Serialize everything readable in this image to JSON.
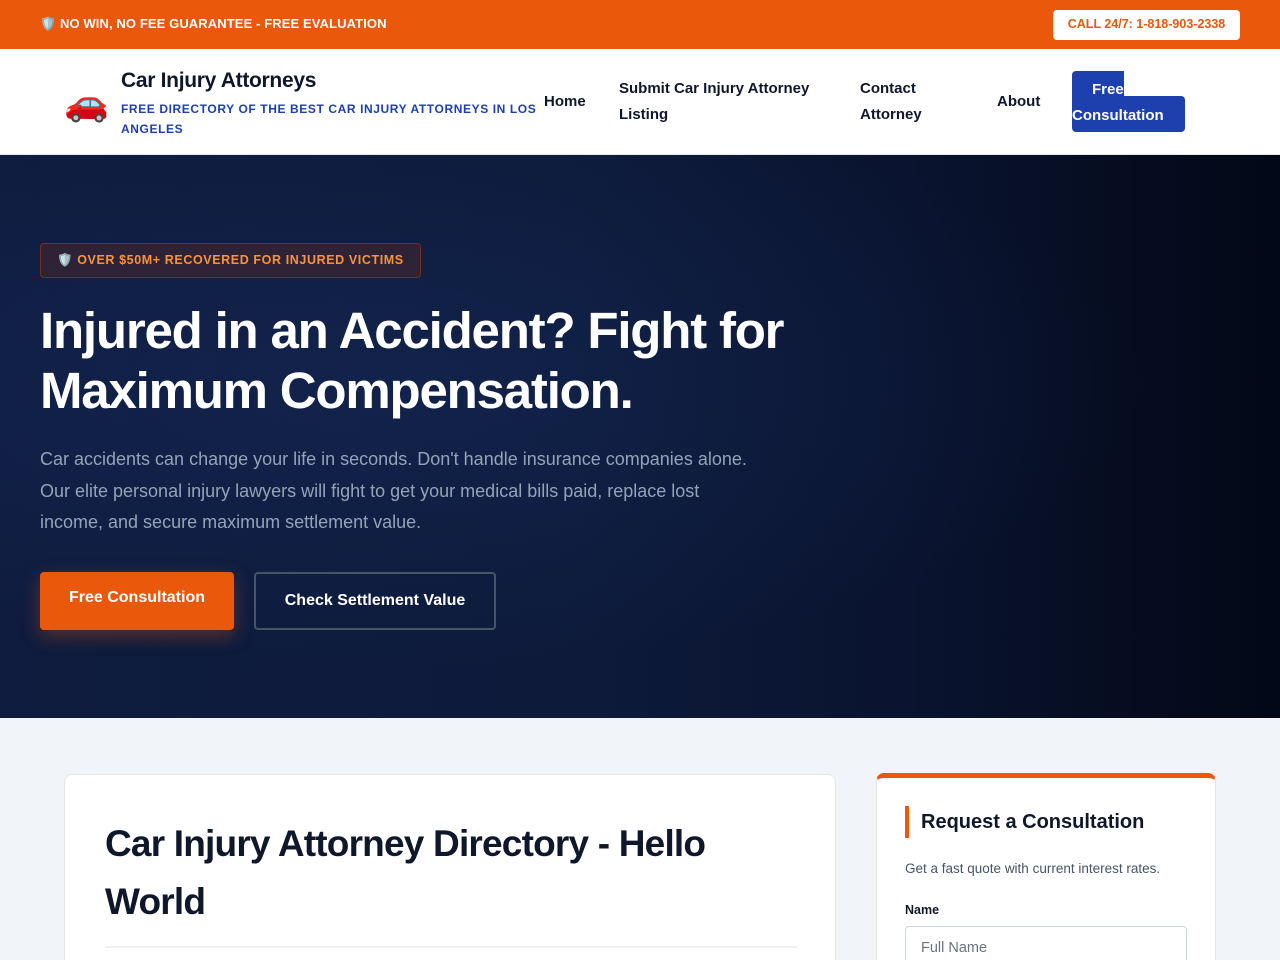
{
  "topbar": {
    "guarantee": "🛡️ NO WIN, NO FEE GUARANTEE - FREE EVALUATION",
    "call": "CALL 24/7: 1-818-903-2338"
  },
  "header": {
    "logo_emoji": "🚗",
    "title": "Car Injury Attorneys",
    "subtitle": "FREE DIRECTORY OF THE BEST CAR INJURY ATTORNEYS IN LOS ANGELES",
    "nav": {
      "home": "Home",
      "submit": "Submit Car Injury Attorney Listing",
      "contact": "Contact Attorney",
      "about": "About",
      "cta_line1": "Free",
      "cta_line2": "Consultation"
    }
  },
  "hero": {
    "badge": "🛡️ OVER $50M+ RECOVERED FOR INJURED VICTIMS",
    "title": "Injured in an Accident? Fight for Maximum Compensation.",
    "text": "Car accidents can change your life in seconds. Don't handle insurance companies alone. Our elite personal injury lawyers will fight to get your medical bills paid, replace lost income, and secure maximum settlement value.",
    "primary_button": "Free Consultation",
    "secondary_button": "Check Settlement Value"
  },
  "main": {
    "title": "Car Injury Attorney Directory - Hello World"
  },
  "sidebar": {
    "title": "Request a Consultation",
    "subtitle": "Get a fast quote with current interest rates.",
    "name_label": "Name",
    "name_placeholder": "Full Name"
  },
  "colors": {
    "accent": "#ea580c",
    "brand_blue": "#1e40af",
    "hero_dark": "#0f1c3f"
  }
}
